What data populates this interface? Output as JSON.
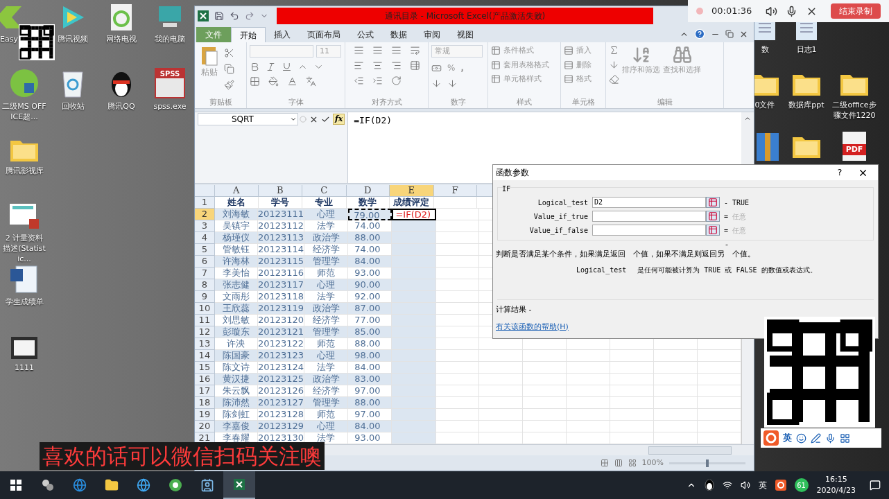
{
  "desktop": {
    "icons": [
      {
        "kind": "arrow",
        "label": "Easy"
      },
      {
        "kind": "play",
        "label": "腾讯视频"
      },
      {
        "kind": "doc-e",
        "label": "网络电视"
      },
      {
        "kind": "pc",
        "label": "我的电脑"
      },
      {
        "kind": "globe",
        "label": "二级MS OFFICE超..."
      },
      {
        "kind": "recycle",
        "label": "回收站"
      },
      {
        "kind": "penguin",
        "label": "腾讯QQ"
      },
      {
        "kind": "chart",
        "label": "spss.exe",
        "badge": "SPSS"
      },
      {
        "kind": "folder",
        "label": "腾讯影视库"
      },
      {
        "kind": "slide",
        "label": "2 计量资料描述(Statistic..."
      },
      {
        "kind": "word",
        "label": "学生成绩单"
      },
      {
        "kind": "window",
        "label": "1111"
      },
      {
        "kind": "doc",
        "label": "数"
      },
      {
        "kind": "doc",
        "label": "日志1"
      },
      {
        "kind": "folder",
        "label": "0文件"
      },
      {
        "kind": "folder",
        "label": "数据库ppt"
      },
      {
        "kind": "folder",
        "label": "二级office步骤文件1220"
      },
      {
        "kind": "archive"
      },
      {
        "kind": "folder"
      },
      {
        "kind": "pdf",
        "badge": "PDF"
      }
    ]
  },
  "excel": {
    "title": "通讯目录 - Microsoft Excel(产品激活失败)",
    "tabs": [
      {
        "label": "文件",
        "kind": "file",
        "selected": false
      },
      {
        "label": "开始",
        "kind": "tab",
        "selected": true
      },
      {
        "label": "插入",
        "kind": "tab",
        "selected": false
      },
      {
        "label": "页面布局",
        "kind": "tab",
        "selected": false
      },
      {
        "label": "公式",
        "kind": "tab",
        "selected": false
      },
      {
        "label": "数据",
        "kind": "tab",
        "selected": false
      },
      {
        "label": "审阅",
        "kind": "tab",
        "selected": false
      },
      {
        "label": "视图",
        "kind": "tab",
        "selected": false
      }
    ],
    "ribbon": {
      "disabled": true,
      "clipboard": {
        "label": "剪贴板",
        "paste": "粘贴"
      },
      "font": {
        "label": "字体",
        "size": "11"
      },
      "alignment": {
        "label": "对齐方式"
      },
      "number": {
        "label": "数字",
        "format": "常规",
        "percent": "%",
        "comma": ","
      },
      "styles": {
        "label": "样式",
        "items": [
          "条件格式",
          "套用表格格式",
          "单元格样式"
        ]
      },
      "cells": {
        "label": "单元格",
        "items": [
          "插入",
          "删除",
          "格式"
        ]
      },
      "editing": {
        "label": "编辑",
        "items": [
          "排序和筛选",
          "查找和选择"
        ]
      }
    },
    "formula_bar": {
      "name_box": "SQRT",
      "fx": "fx",
      "formula": "=IF(D2)"
    },
    "columns": [
      {
        "label": "A",
        "selected": false
      },
      {
        "label": "B",
        "selected": false
      },
      {
        "label": "C",
        "selected": false
      },
      {
        "label": "D",
        "selected": false
      },
      {
        "label": "E",
        "selected": true
      },
      {
        "label": "F",
        "selected": false
      }
    ],
    "header_row": {
      "number": "1",
      "cells": [
        "姓名",
        "学号",
        "专业",
        "数学",
        "成绩评定"
      ]
    },
    "rows": [
      {
        "number": "2",
        "selected": true,
        "reference": true,
        "cells": [
          "刘海敏",
          "20123111",
          "心理",
          "79.00"
        ],
        "editing": "=IF(D2)"
      },
      {
        "number": "3",
        "selected": false,
        "reference": false,
        "cells": [
          "吴镇宇",
          "20123112",
          "法学",
          "74.00"
        ]
      },
      {
        "number": "4",
        "selected": false,
        "reference": false,
        "cells": [
          "杨瑾仪",
          "20123113",
          "政治学",
          "88.00"
        ]
      },
      {
        "number": "5",
        "selected": false,
        "reference": false,
        "cells": [
          "管敏钰",
          "20123114",
          "经济学",
          "74.00"
        ]
      },
      {
        "number": "6",
        "selected": false,
        "reference": false,
        "cells": [
          "许海林",
          "20123115",
          "管理学",
          "84.00"
        ]
      },
      {
        "number": "7",
        "selected": false,
        "reference": false,
        "cells": [
          "李美怡",
          "20123116",
          "师范",
          "93.00"
        ]
      },
      {
        "number": "8",
        "selected": false,
        "reference": false,
        "cells": [
          "张志健",
          "20123117",
          "心理",
          "90.00"
        ]
      },
      {
        "number": "9",
        "selected": false,
        "reference": false,
        "cells": [
          "文雨彤",
          "20123118",
          "法学",
          "92.00"
        ]
      },
      {
        "number": "10",
        "selected": false,
        "reference": false,
        "cells": [
          "王欣蕊",
          "20123119",
          "政治学",
          "87.00"
        ]
      },
      {
        "number": "11",
        "selected": false,
        "reference": false,
        "cells": [
          "刘思敏",
          "20123120",
          "经济学",
          "77.00"
        ]
      },
      {
        "number": "12",
        "selected": false,
        "reference": false,
        "cells": [
          "彭璇东",
          "20123121",
          "管理学",
          "85.00"
        ]
      },
      {
        "number": "13",
        "selected": false,
        "reference": false,
        "cells": [
          "许泱",
          "20123122",
          "师范",
          "88.00"
        ]
      },
      {
        "number": "14",
        "selected": false,
        "reference": false,
        "cells": [
          "陈国豪",
          "20123123",
          "心理",
          "98.00"
        ]
      },
      {
        "number": "15",
        "selected": false,
        "reference": false,
        "cells": [
          "陈文诗",
          "20123124",
          "法学",
          "84.00"
        ]
      },
      {
        "number": "16",
        "selected": false,
        "reference": false,
        "cells": [
          "黄汉捷",
          "20123125",
          "政治学",
          "83.00"
        ]
      },
      {
        "number": "17",
        "selected": false,
        "reference": false,
        "cells": [
          "朱云飘",
          "20123126",
          "经济学",
          "97.00"
        ]
      },
      {
        "number": "18",
        "selected": false,
        "reference": false,
        "cells": [
          "陈沛然",
          "20123127",
          "管理学",
          "88.00"
        ]
      },
      {
        "number": "19",
        "selected": false,
        "reference": false,
        "cells": [
          "陈剑虹",
          "20123128",
          "师范",
          "97.00"
        ]
      },
      {
        "number": "20",
        "selected": false,
        "reference": false,
        "cells": [
          "李嘉俊",
          "20123129",
          "心理",
          "84.00"
        ]
      },
      {
        "number": "21",
        "selected": false,
        "reference": false,
        "cells": [
          "李春耀",
          "20123130",
          "法学",
          "93.00"
        ]
      }
    ],
    "zoom": "100%",
    "zoom_slider": {
      "level": 0.5
    }
  },
  "dialog": {
    "title": "函数参数",
    "help": "?",
    "function": "IF",
    "args": [
      {
        "label": "Logical_test",
        "value": "D2",
        "sign": "-",
        "result": "TRUE",
        "muted": false
      },
      {
        "label": "Value_if_true",
        "sign": "=",
        "result": "任意",
        "muted": true
      },
      {
        "label": "Value_if_false",
        "sign": "=",
        "result": "任意",
        "muted": true
      }
    ],
    "separator": "-",
    "description": "判断是否满足某个条件，如果满足返回　个值，如果不满足则返回另　个值。",
    "arg_name": "Logical_test",
    "arg_help": "是任何可能被计算为 TRUE 或 FALSE 的数值或表达式。",
    "result_label": "计算结果 -",
    "help_link": "有关该函数的帮助(H)"
  },
  "recorder": {
    "time": "00:01:36",
    "stop": "结束录制"
  },
  "caption": "喜欢的话可以微信扫码关注噢",
  "ime_bar": {
    "mode": "英"
  },
  "taskbar": {
    "apps": [
      {
        "kind": "taskview",
        "selected": false
      },
      {
        "kind": "edge",
        "selected": false
      },
      {
        "kind": "explorer",
        "selected": false
      },
      {
        "kind": "ie",
        "selected": false
      },
      {
        "kind": "browser360",
        "selected": false
      },
      {
        "kind": "contacts",
        "selected": false
      },
      {
        "kind": "excel",
        "selected": true
      }
    ],
    "ime": "英",
    "badge": "61",
    "time": "16:15",
    "date": "2020/4/23"
  }
}
